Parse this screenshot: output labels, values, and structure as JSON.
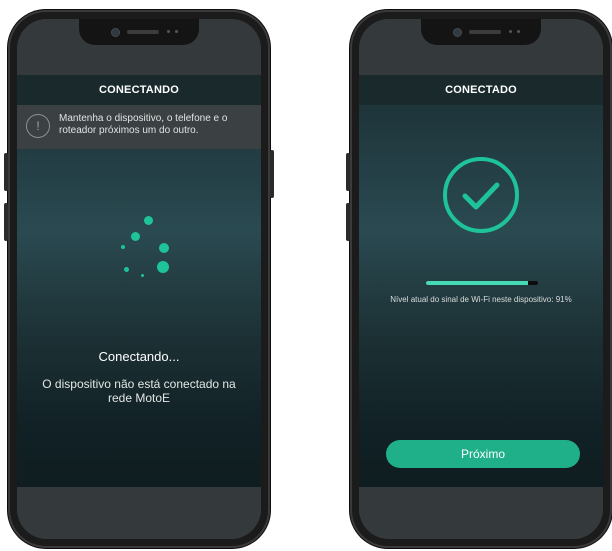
{
  "connecting_screen": {
    "title": "CONECTANDO",
    "banner": {
      "icon": "alert-circle-icon",
      "message": "Mantenha o dispositivo, o telefone e o roteador próximos um do outro."
    },
    "spinner_icon": "loading-spinner-icon",
    "status_label": "Conectando...",
    "status_description": "O dispositivo não está conectado na rede MotoE"
  },
  "connected_screen": {
    "title": "CONECTADO",
    "success_icon": "check-circle-icon",
    "signal_strength_percent": 91,
    "signal_text": "Nível atual do sinal de Wi-Fi neste dispositivo: 91%",
    "next_button_label": "Próximo"
  },
  "colors": {
    "accent": "#1fc39a",
    "button": "#1fb08a",
    "signal_bar": "#46d9b5",
    "app_background": "#223c42",
    "frame": "#1b1b1b"
  }
}
